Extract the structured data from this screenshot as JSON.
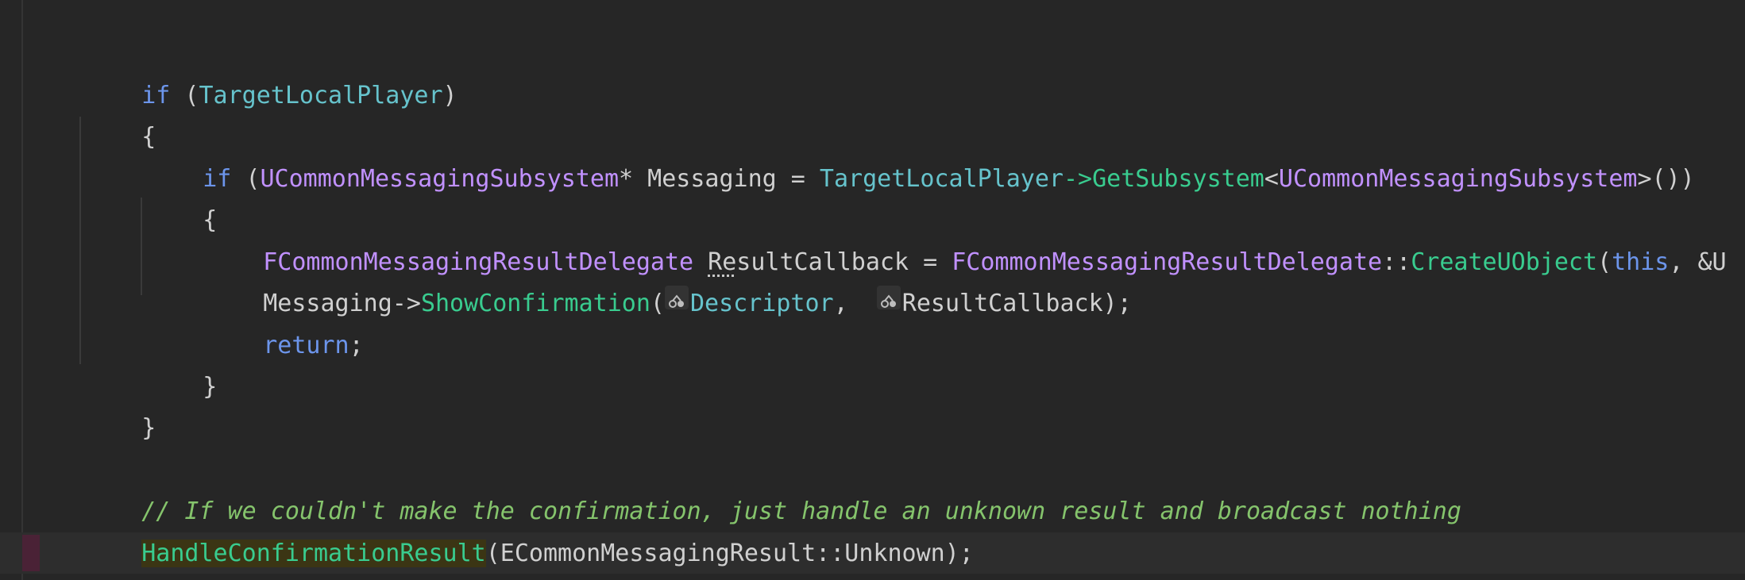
{
  "editor": {
    "lines": [
      {
        "t1": "if",
        "t2": " (",
        "t3": "TargetLocalPlayer",
        "t4": ")"
      },
      {
        "t1": "{"
      },
      {
        "t1": "if",
        "t2": " (",
        "t3": "UCommonMessagingSubsystem",
        "t4": "* Messaging = ",
        "t5": "TargetLocalPlayer",
        "t6": "->",
        "t7": "GetSubsystem",
        "t8": "<",
        "t9": "UCommonMessagingSubsystem",
        "t10": ">())"
      },
      {
        "t1": "{"
      },
      {
        "t1": "FCommonMessagingResultDelegate",
        "t2": " ",
        "t3": "Re",
        "t4": "sultCallback = ",
        "t5": "FCommonMessagingResultDelegate",
        "t6": "::",
        "t7": "CreateUObject",
        "t8": "(",
        "t9": "this",
        "t10": ", &U"
      },
      {
        "t1": "Messaging->",
        "t2": "ShowConfirmation",
        "t3": "(",
        "t4": "Descriptor",
        "t5": ",  ",
        "t6": "ResultCallback);"
      },
      {
        "t1": "return",
        "t2": ";"
      },
      {
        "t1": "}"
      },
      {
        "t1": "}"
      },
      {
        "t1": "// If we couldn't make the confirmation, just handle an unknown result and broadcast nothing"
      },
      {
        "t1": "HandleConfirmationResult",
        "t2": "(ECommonMessagingResult::Unknown);"
      },
      {
        "t1": "}"
      }
    ]
  },
  "icons": {
    "parameter_hint": "parameter-hint-icon"
  },
  "colors": {
    "background": "#262626",
    "keyword": "#6c95eb",
    "type": "#c191ff",
    "variable": "#66c3cc",
    "function": "#39cc8f",
    "comment": "#85c46c"
  }
}
